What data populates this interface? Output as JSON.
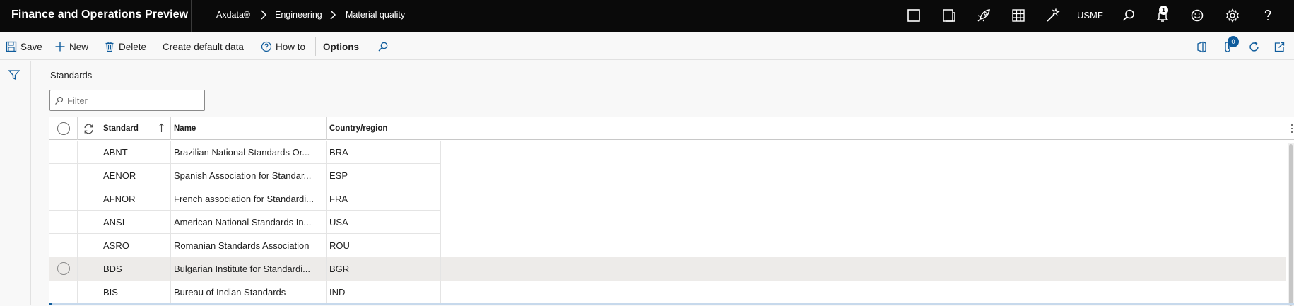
{
  "app": {
    "title": "Finance and Operations Preview"
  },
  "breadcrumb": [
    "Axdata®",
    "Engineering",
    "Material quality"
  ],
  "topbar": {
    "company": "USMF",
    "notification_count": "1"
  },
  "toolbar": {
    "save": "Save",
    "new": "New",
    "delete": "Delete",
    "create_default": "Create default data",
    "how_to": "How to",
    "options": "Options",
    "attachments_count": "0"
  },
  "section": {
    "title": "Standards"
  },
  "filter": {
    "placeholder": "Filter"
  },
  "grid": {
    "columns": [
      "Standard",
      "Name",
      "Country/region"
    ],
    "rows": [
      {
        "standard": "ABNT",
        "name": "Brazilian National Standards Or...",
        "country": "BRA"
      },
      {
        "standard": "AENOR",
        "name": "Spanish Association for Standar...",
        "country": "ESP"
      },
      {
        "standard": "AFNOR",
        "name": "French association for Standardi...",
        "country": "FRA"
      },
      {
        "standard": "ANSI",
        "name": "American National Standards In...",
        "country": "USA"
      },
      {
        "standard": "ASRO",
        "name": "Romanian Standards Association",
        "country": "ROU"
      },
      {
        "standard": "BDS",
        "name": "Bulgarian Institute for Standardi...",
        "country": "BGR"
      },
      {
        "standard": "BIS",
        "name": "Bureau of Indian Standards",
        "country": "IND"
      }
    ]
  },
  "colors": {
    "topbar": "#0a0a0a",
    "accent": "#0f5c9c",
    "hover_row": "#edebe9"
  }
}
